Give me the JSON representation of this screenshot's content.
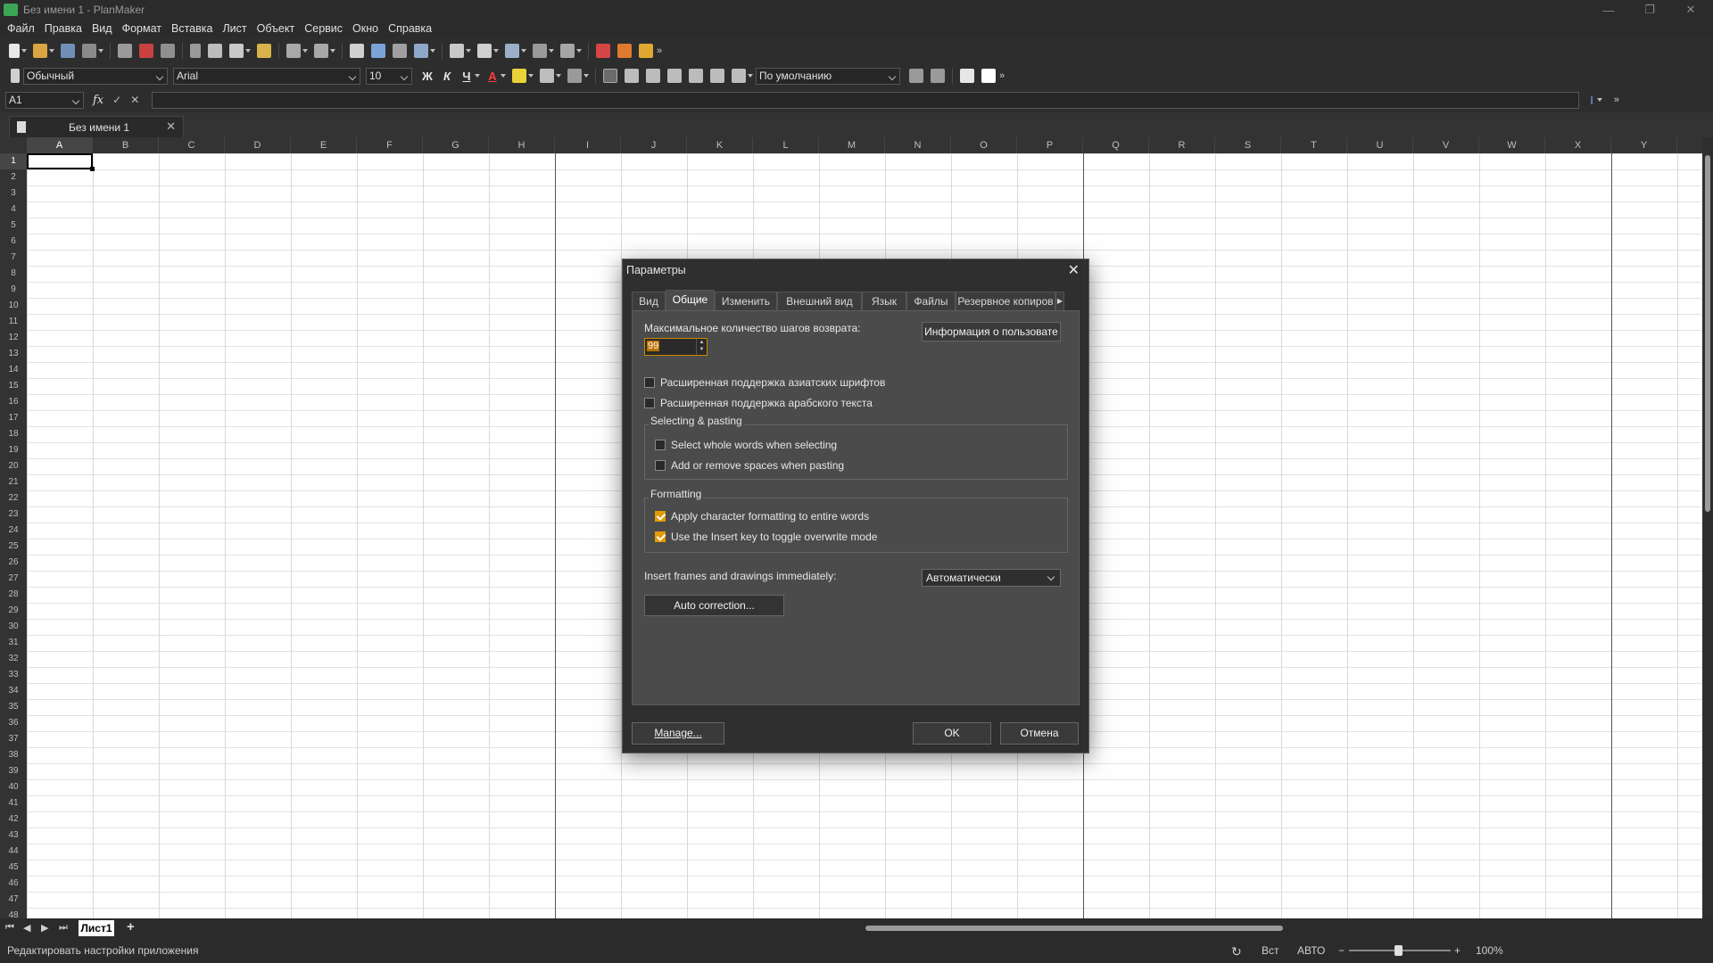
{
  "window": {
    "title": "Без имени 1 - PlanMaker"
  },
  "menu": [
    "Файл",
    "Правка",
    "Вид",
    "Формат",
    "Вставка",
    "Лист",
    "Объект",
    "Сервис",
    "Окно",
    "Справка"
  ],
  "toolbar2": {
    "style": "Обычный",
    "font": "Arial",
    "size": "10",
    "bold": "Ж",
    "italic": "К",
    "underline": "Ч",
    "font_color_glyph": "A",
    "number_format": "По умолчанию"
  },
  "formula_bar": {
    "cell_ref": "A1",
    "fx": "fx"
  },
  "doc_tab": {
    "label": "Без имени 1"
  },
  "columns": [
    "A",
    "B",
    "C",
    "D",
    "E",
    "F",
    "G",
    "H",
    "I",
    "J",
    "K",
    "L",
    "M",
    "N",
    "O",
    "P",
    "Q",
    "R",
    "S",
    "T",
    "U",
    "V",
    "W",
    "X",
    "Y"
  ],
  "rows": [
    "1",
    "2",
    "3",
    "4",
    "5",
    "6",
    "7",
    "8",
    "9",
    "10",
    "11",
    "12",
    "13",
    "14",
    "15",
    "16",
    "17",
    "18",
    "19",
    "20",
    "21",
    "22",
    "23",
    "24",
    "25",
    "26",
    "27",
    "28",
    "29",
    "30",
    "31",
    "32",
    "33",
    "34",
    "35",
    "36",
    "37",
    "38",
    "39",
    "40",
    "41",
    "42",
    "43",
    "44",
    "45",
    "46",
    "47",
    "48"
  ],
  "sheet_tab": "Лист1",
  "status": {
    "text": "Редактировать настройки приложения",
    "insert_mode": "Вст",
    "calc_mode": "АВТО",
    "zoom": "100%"
  },
  "dialog": {
    "title": "Параметры",
    "tabs": [
      "Вид",
      "Общие",
      "Изменить",
      "Внешний вид",
      "Язык",
      "Файлы",
      "Резервное копиров"
    ],
    "selected_tab": "Общие",
    "undo_label": "Максимальное количество шагов возврата:",
    "undo_value": "99",
    "user_info_button": "Информация о пользовате",
    "asian_fonts": "Расширенная поддержка азиатских шрифтов",
    "arabic_text": "Расширенная поддержка арабского текста",
    "selecting_group": "Selecting & pasting",
    "select_whole_words": "Select whole words when selecting",
    "add_remove_spaces": "Add or remove spaces when pasting",
    "formatting_group": "Formatting",
    "apply_char_format": "Apply character formatting to entire words",
    "insert_key": "Use the Insert key to toggle overwrite mode",
    "insert_frames_label": "Insert frames and drawings immediately:",
    "insert_frames_value": "Автоматически",
    "auto_correction_button": "Auto correction...",
    "manage_button": "Manage...",
    "ok_button": "OK",
    "cancel_button": "Отмена"
  },
  "colors": {
    "accent": "#e39b00",
    "chrome": "#2b2b2b",
    "panel": "#4b4b4b"
  }
}
